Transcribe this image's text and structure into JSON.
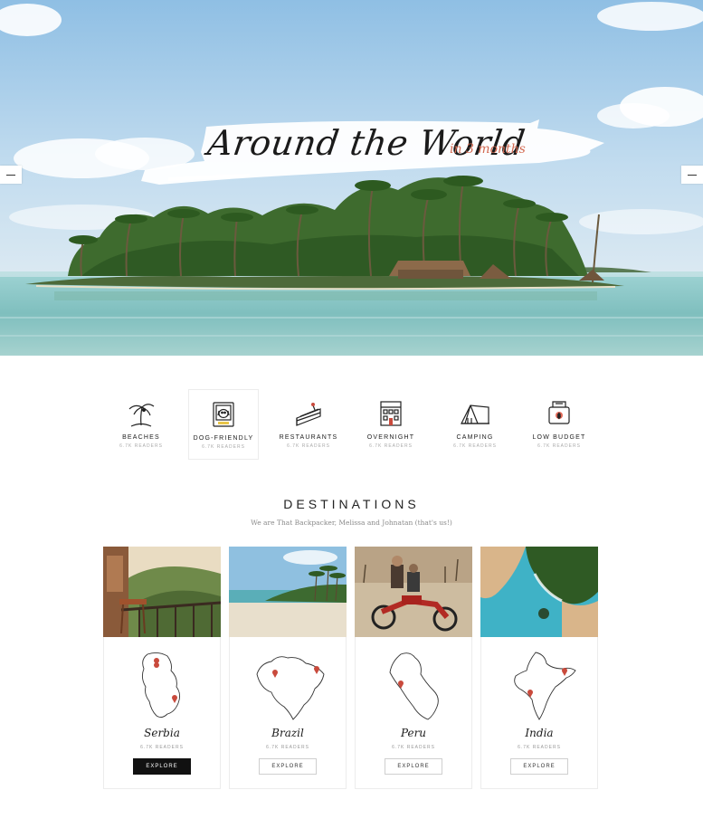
{
  "hero": {
    "title": "Around the World",
    "subtitle": "in 3 months",
    "prev_icon": "arrow-left-icon",
    "next_icon": "arrow-right-icon"
  },
  "categories": [
    {
      "label": "BEACHES",
      "readers": "6.7K READERS",
      "icon": "palm-tree-icon"
    },
    {
      "label": "DOG-FRIENDLY",
      "readers": "6.7K READERS",
      "icon": "dog-icon"
    },
    {
      "label": "RESTAURANTS",
      "readers": "6.7K READERS",
      "icon": "cake-icon"
    },
    {
      "label": "OVERNIGHT",
      "readers": "6.7K READERS",
      "icon": "building-icon"
    },
    {
      "label": "CAMPING",
      "readers": "6.7K READERS",
      "icon": "tent-icon"
    },
    {
      "label": "LOW BUDGET",
      "readers": "6.7K READERS",
      "icon": "wallet-icon"
    }
  ],
  "destinations": {
    "title": "DESTINATIONS",
    "subtitle": "We are That Backpacker, Melissa and Johnatan (that's us!)",
    "items": [
      {
        "name": "Serbia",
        "readers": "6.7K READERS",
        "button": "EXPLORE"
      },
      {
        "name": "Brazil",
        "readers": "6.7K READERS",
        "button": "EXPLORE"
      },
      {
        "name": "Peru",
        "readers": "6.7K READERS",
        "button": "EXPLORE"
      },
      {
        "name": "India",
        "readers": "6.7K READERS",
        "button": "EXPLORE"
      }
    ]
  },
  "colors": {
    "accent": "#d36a52",
    "dark_button": "#111111",
    "sky": "#a9cce6",
    "sea": "#8cc4c2",
    "pin": "#c94a3c"
  }
}
